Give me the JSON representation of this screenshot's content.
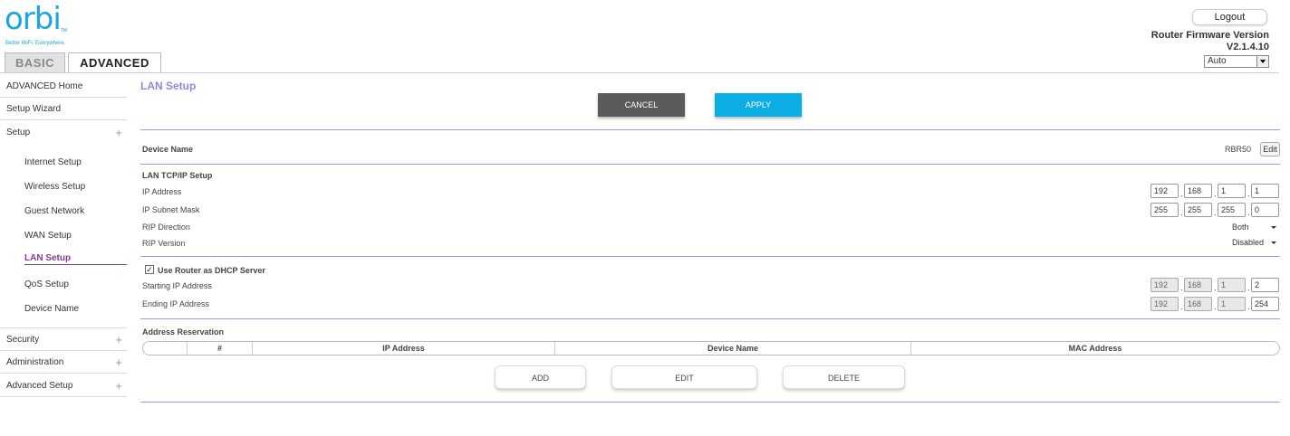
{
  "header": {
    "logo": "orbi",
    "logo_tm": "TM",
    "tagline": "Better WiFi. Everywhere.",
    "tabs": {
      "basic": "BASIC",
      "advanced": "ADVANCED"
    },
    "logout": "Logout",
    "firmware_label": "Router Firmware Version",
    "firmware_version": "V2.1.4.10",
    "language_select": "Auto"
  },
  "sidebar": {
    "home": "ADVANCED Home",
    "wizard": "Setup Wizard",
    "setup": "Setup",
    "setup_plus": "+",
    "sub": {
      "internet": "Internet Setup",
      "wireless": "Wireless Setup",
      "guest": "Guest Network",
      "wan": "WAN Setup",
      "lan": "LAN Setup",
      "qos": "QoS Setup",
      "device": "Device Name"
    },
    "security": "Security",
    "administration": "Administration",
    "advanced_setup": "Advanced Setup",
    "plus": "+"
  },
  "main": {
    "title": "LAN Setup",
    "cancel": "CANCEL",
    "apply": "APPLY",
    "device_name_label": "Device Name",
    "device_name_value": "RBR50",
    "edit": "Edit",
    "lan_section": "LAN TCP/IP Setup",
    "ip_address_label": "IP Address",
    "ip_address": [
      "192",
      "168",
      "1",
      "1"
    ],
    "subnet_label": "IP Subnet Mask",
    "subnet": [
      "255",
      "255",
      "255",
      "0"
    ],
    "rip_direction_label": "RIP Direction",
    "rip_direction": "Both",
    "rip_version_label": "RIP Version",
    "rip_version": "Disabled",
    "dhcp_check": "✓",
    "dhcp_label": "Use Router as DHCP Server",
    "start_ip_label": "Starting IP Address",
    "start_ip": [
      "192",
      "168",
      "1",
      "2"
    ],
    "end_ip_label": "Ending IP Address",
    "end_ip": [
      "192",
      "168",
      "1",
      "254"
    ],
    "reservation_label": "Address Reservation",
    "table_headers": [
      "",
      "#",
      "IP Address",
      "Device Name",
      "MAC Address"
    ],
    "add": "ADD",
    "edit_btn": "EDIT",
    "delete": "DELETE",
    "dot": "."
  }
}
